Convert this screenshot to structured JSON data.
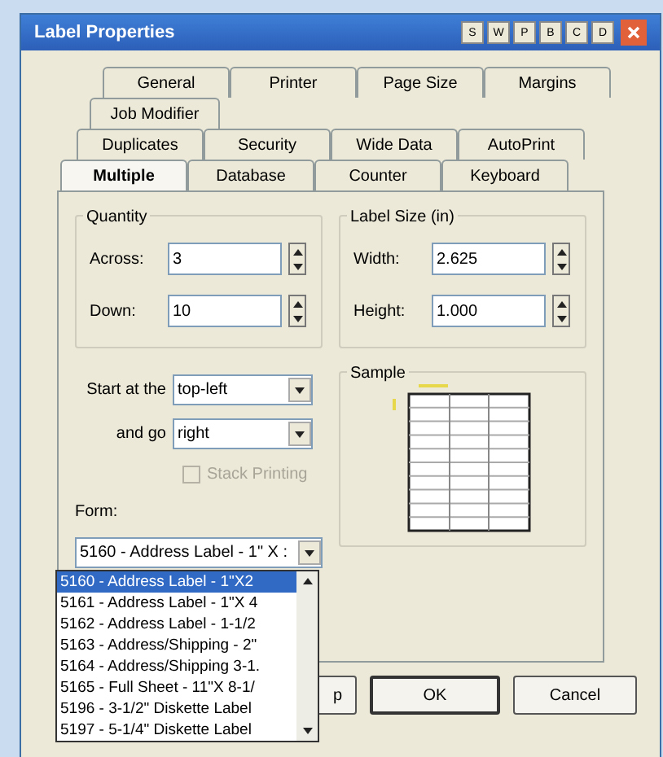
{
  "window": {
    "title": "Label Properties",
    "title_buttons": [
      "S",
      "W",
      "P",
      "B",
      "C",
      "D"
    ]
  },
  "tab_rows": [
    [
      {
        "label": "General",
        "selected": false
      },
      {
        "label": "Printer",
        "selected": false
      },
      {
        "label": "Page Size",
        "selected": false
      },
      {
        "label": "Margins",
        "selected": false
      }
    ],
    [
      {
        "label": "Job Modifier",
        "selected": false
      }
    ],
    [
      {
        "label": "Duplicates",
        "selected": false
      },
      {
        "label": "Security",
        "selected": false
      },
      {
        "label": "Wide Data",
        "selected": false
      },
      {
        "label": "AutoPrint",
        "selected": false
      }
    ],
    [
      {
        "label": "Multiple",
        "selected": true
      },
      {
        "label": "Database",
        "selected": false
      },
      {
        "label": "Counter",
        "selected": false
      },
      {
        "label": "Keyboard",
        "selected": false
      }
    ]
  ],
  "quantity": {
    "title": "Quantity",
    "fields": [
      {
        "label": "Across:",
        "value": "3"
      },
      {
        "label": "Down:",
        "value": "10"
      }
    ]
  },
  "label_size": {
    "title": "Label Size (in)",
    "fields": [
      {
        "label": "Width:",
        "value": "2.625"
      },
      {
        "label": "Height:",
        "value": "1.000"
      }
    ]
  },
  "start": {
    "label": "Start at the",
    "value": "top-left"
  },
  "direction": {
    "label": "and go",
    "value": "right"
  },
  "stack_printing": {
    "label": "Stack Printing",
    "checked": false,
    "disabled": true
  },
  "form": {
    "label": "Form:",
    "value": "5160 - Address Label - 1\" X :",
    "options": [
      {
        "label": "5160 - Address Label - 1\"X2",
        "selected": true
      },
      {
        "label": "5161 - Address Label - 1\"X 4",
        "selected": false
      },
      {
        "label": "5162 - Address Label - 1-1/2",
        "selected": false
      },
      {
        "label": "5163 - Address/Shipping - 2\"",
        "selected": false
      },
      {
        "label": "5164 - Address/Shipping 3-1.",
        "selected": false
      },
      {
        "label": "5165 - Full Sheet - 11\"X 8-1/",
        "selected": false
      },
      {
        "label": "5196 - 3-1/2\" Diskette Label",
        "selected": false
      },
      {
        "label": "5197 - 5-1/4\" Diskette Label",
        "selected": false
      }
    ]
  },
  "sample": {
    "title": "Sample"
  },
  "buttons": [
    "p",
    "OK",
    "Cancel"
  ]
}
